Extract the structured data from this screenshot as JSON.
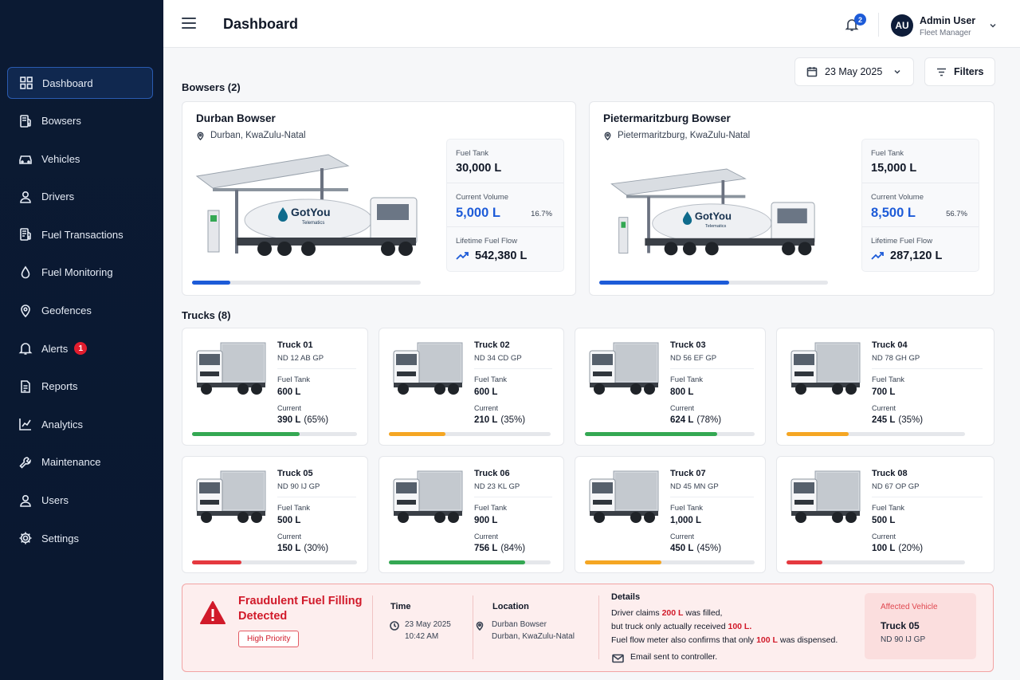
{
  "sidebar": {
    "items": [
      {
        "label": "Dashboard",
        "icon": "dashboard-icon",
        "active": true
      },
      {
        "label": "Bowsers",
        "icon": "bowser-icon"
      },
      {
        "label": "Vehicles",
        "icon": "vehicle-icon"
      },
      {
        "label": "Drivers",
        "icon": "driver-icon"
      },
      {
        "label": "Fuel Transactions",
        "icon": "fuel-transactions-icon"
      },
      {
        "label": "Fuel Monitoring",
        "icon": "fuel-drop-icon"
      },
      {
        "label": "Geofences",
        "icon": "geofence-pin-icon"
      },
      {
        "label": "Alerts",
        "icon": "alert-bell-icon",
        "badge": "1"
      },
      {
        "label": "Reports",
        "icon": "report-icon"
      },
      {
        "label": "Analytics",
        "icon": "analytics-icon"
      },
      {
        "label": "Maintenance",
        "icon": "wrench-icon"
      },
      {
        "label": "Users",
        "icon": "user-icon"
      },
      {
        "label": "Settings",
        "icon": "gear-icon"
      }
    ]
  },
  "header": {
    "title": "Dashboard",
    "notifications": "2",
    "user": {
      "initials": "AU",
      "name": "Admin User",
      "role": "Fleet Manager"
    }
  },
  "toolbar": {
    "date": "23 May 2025",
    "filters_label": "Filters"
  },
  "bowsers_title": "Bowsers (2)",
  "bowsers": [
    {
      "name": "Durban Bowser",
      "location": "Durban, KwaZulu-Natal",
      "tank_label": "Fuel Tank",
      "tank_value": "30,000 L",
      "current_label": "Current Volume",
      "current_value": "5,000 L",
      "current_pct": "16.7%",
      "fill_fraction": 0.167,
      "flow_label": "Lifetime Fuel Flow",
      "flow_value": "542,380 L",
      "logo_text": "GotYou",
      "logo_sub": "Telematics"
    },
    {
      "name": "Pietermaritzburg Bowser",
      "location": "Pietermaritzburg, KwaZulu-Natal",
      "tank_label": "Fuel Tank",
      "tank_value": "15,000 L",
      "current_label": "Current Volume",
      "current_value": "8,500 L",
      "current_pct": "56.7%",
      "fill_fraction": 0.567,
      "flow_label": "Lifetime Fuel Flow",
      "flow_value": "287,120 L",
      "logo_text": "GotYou",
      "logo_sub": "Telematics"
    }
  ],
  "trucks_title": "Trucks (8)",
  "trucks": [
    {
      "name": "Truck 01",
      "plate": "ND 12 AB GP",
      "tank_label": "Fuel Tank",
      "tank": "600 L",
      "current_label": "Current",
      "current": "390 L",
      "pct": "(65%)",
      "level": 0.65,
      "color": "#34a853"
    },
    {
      "name": "Truck 02",
      "plate": "ND 34 CD GP",
      "tank_label": "Fuel Tank",
      "tank": "600 L",
      "current_label": "Current",
      "current": "210 L",
      "pct": "(35%)",
      "level": 0.35,
      "color": "#f5a623"
    },
    {
      "name": "Truck 03",
      "plate": "ND 56 EF GP",
      "tank_label": "Fuel Tank",
      "tank": "800 L",
      "current_label": "Current",
      "current": "624 L",
      "pct": "(78%)",
      "level": 0.78,
      "color": "#34a853"
    },
    {
      "name": "Truck 04",
      "plate": "ND 78 GH GP",
      "tank_label": "Fuel Tank",
      "tank": "700 L",
      "current_label": "Current",
      "current": "245 L",
      "pct": "(35%)",
      "level": 0.35,
      "color": "#f5a623"
    },
    {
      "name": "Truck 05",
      "plate": "ND 90 IJ GP",
      "tank_label": "Fuel Tank",
      "tank": "500 L",
      "current_label": "Current",
      "current": "150 L",
      "pct": "(30%)",
      "level": 0.3,
      "color": "#e5393f"
    },
    {
      "name": "Truck 06",
      "plate": "ND 23 KL GP",
      "tank_label": "Fuel Tank",
      "tank": "900 L",
      "current_label": "Current",
      "current": "756 L",
      "pct": "(84%)",
      "level": 0.84,
      "color": "#34a853"
    },
    {
      "name": "Truck 07",
      "plate": "ND 45 MN GP",
      "tank_label": "Fuel Tank",
      "tank": "1,000 L",
      "current_label": "Current",
      "current": "450 L",
      "pct": "(45%)",
      "level": 0.45,
      "color": "#f5a623"
    },
    {
      "name": "Truck 08",
      "plate": "ND 67 OP GP",
      "tank_label": "Fuel Tank",
      "tank": "500 L",
      "current_label": "Current",
      "current": "100 L",
      "pct": "(20%)",
      "level": 0.2,
      "color": "#e5393f"
    }
  ],
  "alert": {
    "title_line1": "Fraudulent Fuel Filling",
    "title_line2": "Detected",
    "priority": "High Priority",
    "time_label": "Time",
    "date": "23 May 2025",
    "time": "10:42 AM",
    "location_label": "Location",
    "location_line1": "Durban Bowser",
    "location_line2": "Durban, KwaZulu-Natal",
    "details_label": "Details",
    "d1_pre": "Driver claims ",
    "d1_val": "200 L",
    "d1_post": " was filled,",
    "d2_pre": "but truck only actually received ",
    "d2_val": "100 L.",
    "d3_pre": "Fuel flow meter also confirms that only ",
    "d3_val": "100 L",
    "d3_post": " was dispensed.",
    "email": "Email sent to controller.",
    "affected_label": "Affected Vehicle",
    "affected_name": "Truck 05",
    "affected_plate": "ND 90 IJ GP"
  },
  "colors": {
    "accent": "#1d5bd8",
    "danger": "#d11a2a",
    "sidebar": "#0b1a33"
  }
}
